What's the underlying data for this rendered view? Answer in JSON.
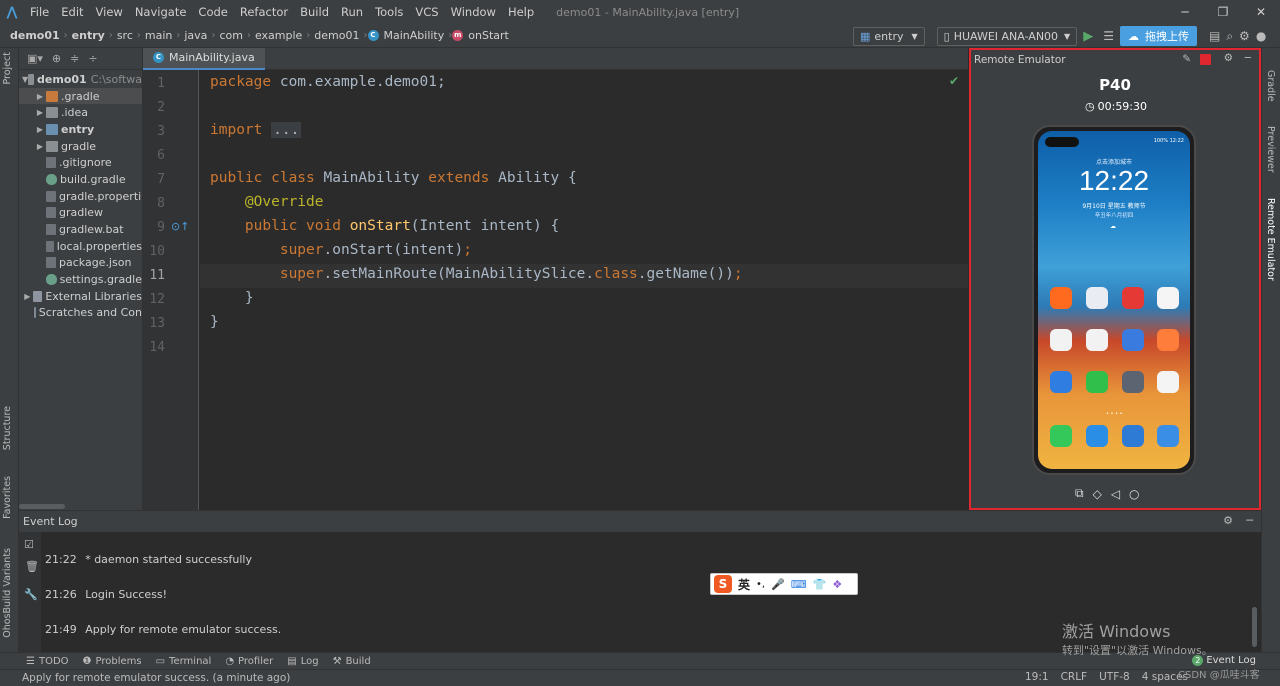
{
  "menubar": {
    "items": [
      "File",
      "Edit",
      "View",
      "Navigate",
      "Code",
      "Refactor",
      "Build",
      "Run",
      "Tools",
      "VCS",
      "Window",
      "Help"
    ],
    "window_title": "demo01 - MainAbility.java [entry]"
  },
  "navbar": {
    "breadcrumbs": [
      "demo01",
      "entry",
      "src",
      "main",
      "java",
      "com",
      "example",
      "demo01",
      "MainAbility",
      "onStart"
    ],
    "run_config": "entry",
    "device": "HUAWEI ANA-AN00",
    "upload_label": "拖拽上传"
  },
  "project": {
    "root": {
      "name": "demo01",
      "path": "C:\\softwa"
    },
    "items": [
      {
        "label": ".gradle",
        "icon": "folder-orange-icon"
      },
      {
        "label": ".idea",
        "icon": "folder-icon"
      },
      {
        "label": "entry",
        "icon": "module-folder-icon"
      },
      {
        "label": "gradle",
        "icon": "folder-icon"
      },
      {
        "label": ".gitignore",
        "icon": "file-icon"
      },
      {
        "label": "build.gradle",
        "icon": "gradle-icon"
      },
      {
        "label": "gradle.properti",
        "icon": "file-icon"
      },
      {
        "label": "gradlew",
        "icon": "file-icon"
      },
      {
        "label": "gradlew.bat",
        "icon": "file-icon"
      },
      {
        "label": "local.properties",
        "icon": "file-icon"
      },
      {
        "label": "package.json",
        "icon": "file-icon"
      },
      {
        "label": "settings.gradle",
        "icon": "gradle-icon"
      }
    ],
    "external_libraries": "External Libraries",
    "scratches": "Scratches and Con"
  },
  "editor": {
    "tab": "MainAbility.java",
    "line_numbers": [
      "1",
      "2",
      "3",
      "6",
      "7",
      "8",
      "9",
      "10",
      "11",
      "12",
      "13",
      "14"
    ]
  },
  "emulator": {
    "title": "Remote Emulator",
    "device_name": "P40",
    "timer": "00:59:30",
    "lockscreen_hint": "点击添加城市",
    "clock": "12:22",
    "date": "9月10日 星期五  教师节",
    "lunar": "辛丑年八月初四",
    "status_time": "12:22",
    "status_battery": "100%"
  },
  "right_tabs": [
    "Gradle",
    "Previewer",
    "Remote Emulator"
  ],
  "left_tabs": [
    "Project",
    "Structure",
    "Favorites",
    "OhosBuild Variants"
  ],
  "event_log": {
    "title": "Event Log",
    "entries": [
      {
        "time": "21:22",
        "text": "* daemon started successfully"
      },
      {
        "time": "21:26",
        "text": "Login Success!"
      },
      {
        "time": "21:49",
        "text": "Apply for remote emulator success."
      }
    ]
  },
  "bottom_tools": [
    "TODO",
    "Problems",
    "Terminal",
    "Profiler",
    "Log",
    "Build"
  ],
  "event_log_button": {
    "count": "2",
    "label": "Event Log"
  },
  "status": {
    "message": "Apply for remote emulator success. (a minute ago)",
    "position": "19:1",
    "line_sep": "CRLF",
    "encoding": "UTF-8",
    "indent": "4 spaces"
  },
  "ime": {
    "mode": "英"
  },
  "watermark": {
    "line1": "激活 Windows",
    "line2": "转到\"设置\"以激活 Windows。",
    "credit": "CSDN @瓜哇斗客"
  },
  "colors": {
    "accent": "#4a9fe0",
    "highlight_border": "#e0262e",
    "keyword": "#cc7832",
    "annotation": "#bbb529",
    "method": "#ffc66d"
  }
}
